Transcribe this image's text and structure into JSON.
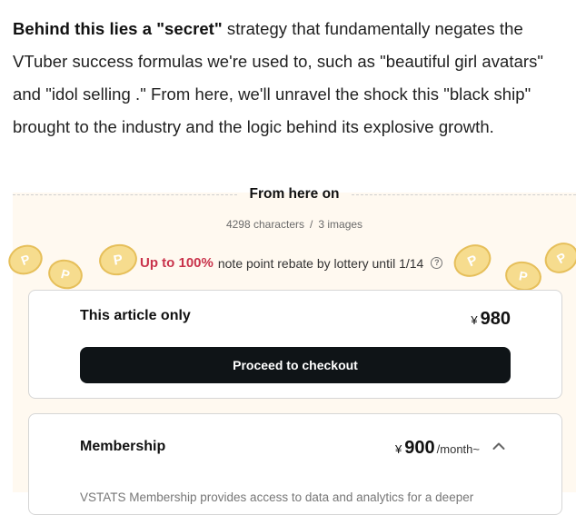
{
  "article": {
    "bold_lead": "Behind this lies a \"secret\"",
    "text": " strategy that fundamentally negates the VTuber success formulas we're used to, such as \"beautiful girl avatars\" and \"idol selling .\" From here, we'll unravel the shock this \"black ship\" brought to the industry and the logic behind its explosive growth."
  },
  "paywall": {
    "divider_label": "From here on",
    "characters": "4298 characters",
    "separator": "/",
    "images": "3 images",
    "rebate_highlight": "Up to 100%",
    "rebate_text": "note point rebate by lottery until 1/14",
    "help_icon": "question-circle-icon"
  },
  "single_purchase": {
    "title": "This article only",
    "currency": "¥",
    "price": "980",
    "button_label": "Proceed to checkout"
  },
  "membership": {
    "title": "Membership",
    "currency": "¥",
    "price": "900",
    "period": "/month~",
    "description": "VSTATS Membership provides access to data and analytics for a deeper",
    "toggle_icon": "chevron-up-icon"
  },
  "colors": {
    "accent_red": "#c9334b",
    "button_dark": "#0f1417",
    "paywall_bg": "#fff9f0",
    "coin": "#f6dc8e"
  }
}
